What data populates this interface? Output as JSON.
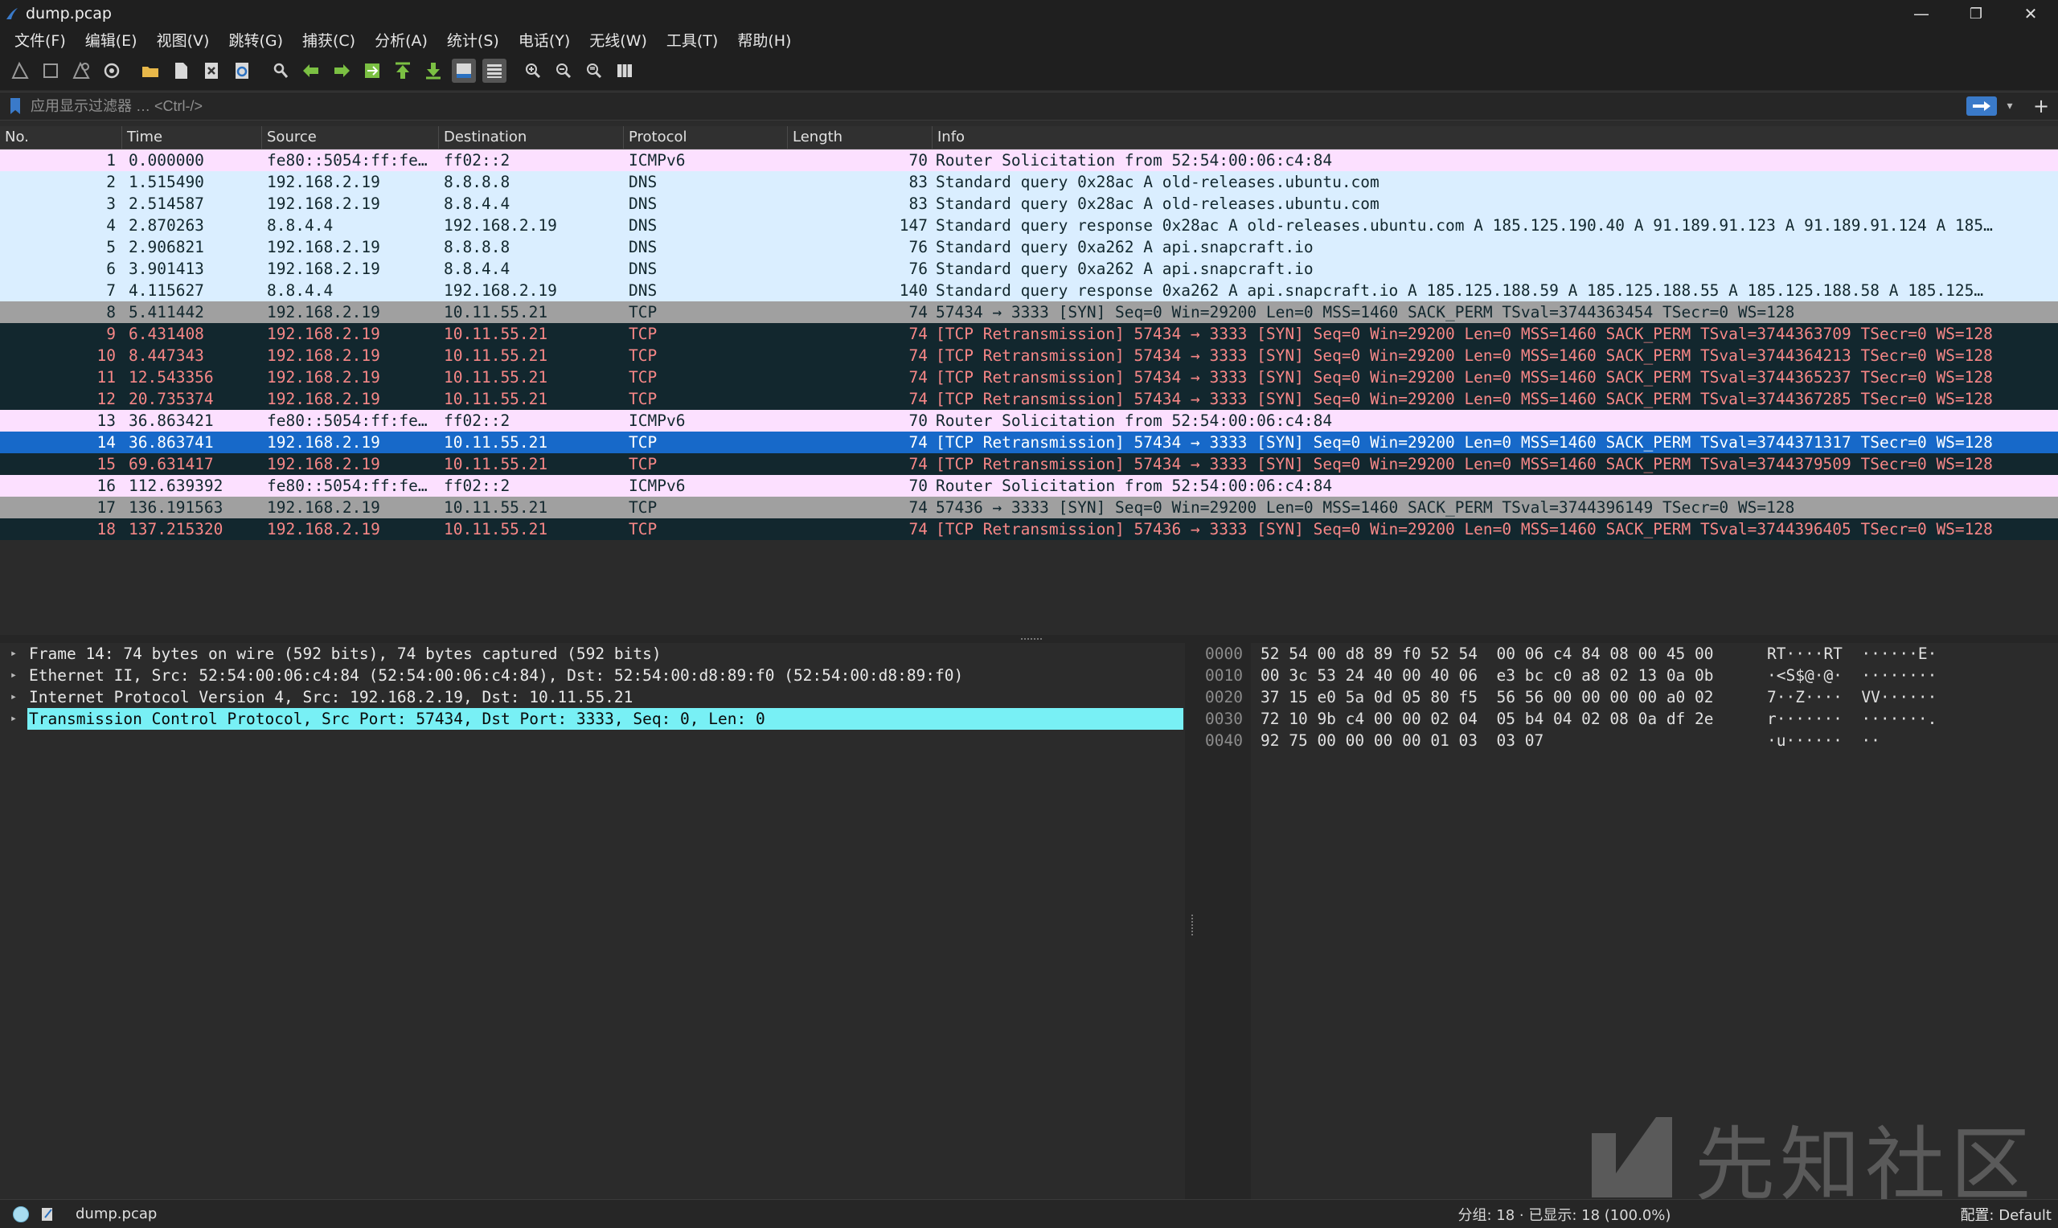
{
  "window": {
    "title": "dump.pcap",
    "minimize": "—",
    "restore": "❐",
    "close": "✕"
  },
  "menu": [
    "文件(F)",
    "编辑(E)",
    "视图(V)",
    "跳转(G)",
    "捕获(C)",
    "分析(A)",
    "统计(S)",
    "电话(Y)",
    "无线(W)",
    "工具(T)",
    "帮助(H)"
  ],
  "toolbar_icons": [
    "shark-fin-start-icon",
    "stop-icon",
    "restart-icon",
    "options-icon",
    "open-folder-icon",
    "file-icon",
    "close-file-icon",
    "reload-icon",
    "search-icon",
    "back-arrow-icon",
    "forward-arrow-icon",
    "goto-packet-icon",
    "first-packet-icon",
    "last-packet-icon",
    "autoscroll-icon",
    "colorize-icon",
    "zoom-in-icon",
    "zoom-out-icon",
    "normal-size-icon",
    "resize-columns-icon"
  ],
  "filter": {
    "placeholder": "应用显示过滤器 … <Ctrl-/>"
  },
  "columns": {
    "no": "No.",
    "time": "Time",
    "source": "Source",
    "destination": "Destination",
    "protocol": "Protocol",
    "length": "Length",
    "info": "Info"
  },
  "packets": [
    {
      "no": "1",
      "time": "0.000000",
      "src": "fe80::5054:ff:fe…",
      "dst": "ff02::2",
      "proto": "ICMPv6",
      "len": "70",
      "info": "Router Solicitation from 52:54:00:06:c4:84",
      "style": "icmp"
    },
    {
      "no": "2",
      "time": "1.515490",
      "src": "192.168.2.19",
      "dst": "8.8.8.8",
      "proto": "DNS",
      "len": "83",
      "info": "Standard query 0x28ac A old-releases.ubuntu.com",
      "style": "dns"
    },
    {
      "no": "3",
      "time": "2.514587",
      "src": "192.168.2.19",
      "dst": "8.8.4.4",
      "proto": "DNS",
      "len": "83",
      "info": "Standard query 0x28ac A old-releases.ubuntu.com",
      "style": "dns"
    },
    {
      "no": "4",
      "time": "2.870263",
      "src": "8.8.4.4",
      "dst": "192.168.2.19",
      "proto": "DNS",
      "len": "147",
      "info": "Standard query response 0x28ac A old-releases.ubuntu.com A 185.125.190.40 A 91.189.91.123 A 91.189.91.124 A 185…",
      "style": "dns"
    },
    {
      "no": "5",
      "time": "2.906821",
      "src": "192.168.2.19",
      "dst": "8.8.8.8",
      "proto": "DNS",
      "len": "76",
      "info": "Standard query 0xa262 A api.snapcraft.io",
      "style": "dns"
    },
    {
      "no": "6",
      "time": "3.901413",
      "src": "192.168.2.19",
      "dst": "8.8.4.4",
      "proto": "DNS",
      "len": "76",
      "info": "Standard query 0xa262 A api.snapcraft.io",
      "style": "dns"
    },
    {
      "no": "7",
      "time": "4.115627",
      "src": "8.8.4.4",
      "dst": "192.168.2.19",
      "proto": "DNS",
      "len": "140",
      "info": "Standard query response 0xa262 A api.snapcraft.io A 185.125.188.59 A 185.125.188.55 A 185.125.188.58 A 185.125…",
      "style": "dns"
    },
    {
      "no": "8",
      "time": "5.411442",
      "src": "192.168.2.19",
      "dst": "10.11.55.21",
      "proto": "TCP",
      "len": "74",
      "info": "57434 → 3333 [SYN] Seq=0 Win=29200 Len=0 MSS=1460 SACK_PERM TSval=3744363454 TSecr=0 WS=128",
      "style": "syn"
    },
    {
      "no": "9",
      "time": "6.431408",
      "src": "192.168.2.19",
      "dst": "10.11.55.21",
      "proto": "TCP",
      "len": "74",
      "info": "[TCP Retransmission] 57434 → 3333 [SYN] Seq=0 Win=29200 Len=0 MSS=1460 SACK_PERM TSval=3744363709 TSecr=0 WS=128",
      "style": "bad"
    },
    {
      "no": "10",
      "time": "8.447343",
      "src": "192.168.2.19",
      "dst": "10.11.55.21",
      "proto": "TCP",
      "len": "74",
      "info": "[TCP Retransmission] 57434 → 3333 [SYN] Seq=0 Win=29200 Len=0 MSS=1460 SACK_PERM TSval=3744364213 TSecr=0 WS=128",
      "style": "bad"
    },
    {
      "no": "11",
      "time": "12.543356",
      "src": "192.168.2.19",
      "dst": "10.11.55.21",
      "proto": "TCP",
      "len": "74",
      "info": "[TCP Retransmission] 57434 → 3333 [SYN] Seq=0 Win=29200 Len=0 MSS=1460 SACK_PERM TSval=3744365237 TSecr=0 WS=128",
      "style": "bad"
    },
    {
      "no": "12",
      "time": "20.735374",
      "src": "192.168.2.19",
      "dst": "10.11.55.21",
      "proto": "TCP",
      "len": "74",
      "info": "[TCP Retransmission] 57434 → 3333 [SYN] Seq=0 Win=29200 Len=0 MSS=1460 SACK_PERM TSval=3744367285 TSecr=0 WS=128",
      "style": "bad"
    },
    {
      "no": "13",
      "time": "36.863421",
      "src": "fe80::5054:ff:fe…",
      "dst": "ff02::2",
      "proto": "ICMPv6",
      "len": "70",
      "info": "Router Solicitation from 52:54:00:06:c4:84",
      "style": "icmp"
    },
    {
      "no": "14",
      "time": "36.863741",
      "src": "192.168.2.19",
      "dst": "10.11.55.21",
      "proto": "TCP",
      "len": "74",
      "info": "[TCP Retransmission] 57434 → 3333 [SYN] Seq=0 Win=29200 Len=0 MSS=1460 SACK_PERM TSval=3744371317 TSecr=0 WS=128",
      "style": "sel"
    },
    {
      "no": "15",
      "time": "69.631417",
      "src": "192.168.2.19",
      "dst": "10.11.55.21",
      "proto": "TCP",
      "len": "74",
      "info": "[TCP Retransmission] 57434 → 3333 [SYN] Seq=0 Win=29200 Len=0 MSS=1460 SACK_PERM TSval=3744379509 TSecr=0 WS=128",
      "style": "bad"
    },
    {
      "no": "16",
      "time": "112.639392",
      "src": "fe80::5054:ff:fe…",
      "dst": "ff02::2",
      "proto": "ICMPv6",
      "len": "70",
      "info": "Router Solicitation from 52:54:00:06:c4:84",
      "style": "icmp"
    },
    {
      "no": "17",
      "time": "136.191563",
      "src": "192.168.2.19",
      "dst": "10.11.55.21",
      "proto": "TCP",
      "len": "74",
      "info": "57436 → 3333 [SYN] Seq=0 Win=29200 Len=0 MSS=1460 SACK_PERM TSval=3744396149 TSecr=0 WS=128",
      "style": "syn"
    },
    {
      "no": "18",
      "time": "137.215320",
      "src": "192.168.2.19",
      "dst": "10.11.55.21",
      "proto": "TCP",
      "len": "74",
      "info": "[TCP Retransmission] 57436 → 3333 [SYN] Seq=0 Win=29200 Len=0 MSS=1460 SACK_PERM TSval=3744396405 TSecr=0 WS=128",
      "style": "bad"
    }
  ],
  "detail": [
    {
      "text": "Frame 14: 74 bytes on wire (592 bits), 74 bytes captured (592 bits)",
      "selected": false
    },
    {
      "text": "Ethernet II, Src: 52:54:00:06:c4:84 (52:54:00:06:c4:84), Dst: 52:54:00:d8:89:f0 (52:54:00:d8:89:f0)",
      "selected": false
    },
    {
      "text": "Internet Protocol Version 4, Src: 192.168.2.19, Dst: 10.11.55.21",
      "selected": false
    },
    {
      "text": "Transmission Control Protocol, Src Port: 57434, Dst Port: 3333, Seq: 0, Len: 0",
      "selected": true
    }
  ],
  "bytes": [
    {
      "offset": "0000",
      "hex": "52 54 00 d8 89 f0 52 54  00 06 c4 84 08 00 45 00",
      "ascii": "RT····RT  ······E·"
    },
    {
      "offset": "0010",
      "hex": "00 3c 53 24 40 00 40 06  e3 bc c0 a8 02 13 0a 0b",
      "ascii": "·<S$@·@·  ········"
    },
    {
      "offset": "0020",
      "hex": "37 15 e0 5a 0d 05 80 f5  56 56 00 00 00 00 a0 02",
      "ascii": "7··Z····  VV······"
    },
    {
      "offset": "0030",
      "hex": "72 10 9b c4 00 00 02 04  05 b4 04 02 08 0a df 2e",
      "ascii": "r·······  ·······."
    },
    {
      "offset": "0040",
      "hex": "92 75 00 00 00 00 01 03  03 07",
      "ascii": "·u······  ··"
    }
  ],
  "watermark": {
    "text": "先知社区"
  },
  "status": {
    "file": "dump.pcap",
    "packets": "分组: 18 · 已显示: 18 (100.0%)",
    "profile": "配置: Default"
  },
  "colors": {
    "icmp_bg": "#fce0ff",
    "dns_bg": "#daeeff",
    "syn_bg": "#a0a0a0",
    "bad_bg": "#12272e",
    "bad_fg": "#f78787",
    "selected_bg": "#1769c9",
    "detail_selected_bg": "#78f0f5"
  }
}
